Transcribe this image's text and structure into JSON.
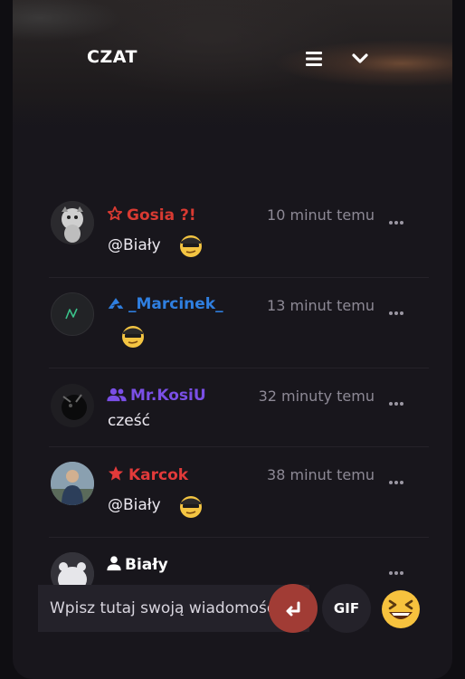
{
  "header": {
    "title": "CZAT",
    "menu_icon": "hamburger-icon",
    "collapse_icon": "chevron-down-icon"
  },
  "messages": [
    {
      "username": "Gosia ?!",
      "username_color": "#d83a32",
      "badge_icon": "star-outline-icon",
      "time": "10 minut temu",
      "text": "@Biały",
      "emote": "shades-smirk-emote"
    },
    {
      "username": "_Marcinek_",
      "username_color": "#2f7fe0",
      "badge_icon": "arrow-logo-icon",
      "time": "13 minut temu",
      "text": "",
      "emote": "shades-smirk-emote"
    },
    {
      "username": "Mr.KosiU",
      "username_color": "#7a4fe6",
      "badge_icon": "users-icon",
      "time": "32 minuty temu",
      "text": "cześć"
    },
    {
      "username": "Karcok",
      "username_color": "#e23a3a",
      "badge_icon": "star-filled-icon",
      "time": "38 minut temu",
      "text": "@Biały",
      "emote": "shades-smirk-emote"
    },
    {
      "username": "Biały",
      "username_color": "#ffffff",
      "badge_icon": "user-icon",
      "time": ""
    }
  ],
  "composer": {
    "placeholder": "Wpisz tutaj swoją wiadomość",
    "send_icon": "enter-icon",
    "gif_label": "GIF",
    "emoji_icon": "laughing-emoji-icon"
  }
}
